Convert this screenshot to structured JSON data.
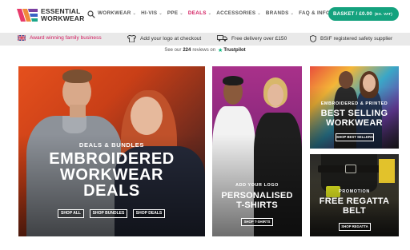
{
  "header": {
    "logo_line1": "ESSENTIAL",
    "logo_line2": "WORKWEAR",
    "nav": [
      {
        "label": "WORKWEAR",
        "has_dropdown": true
      },
      {
        "label": "HI-VIS",
        "has_dropdown": true
      },
      {
        "label": "PPE",
        "has_dropdown": true
      },
      {
        "label": "DEALS",
        "has_dropdown": true
      },
      {
        "label": "ACCESSORIES",
        "has_dropdown": true
      },
      {
        "label": "BRANDS",
        "has_dropdown": true
      },
      {
        "label": "FAQ & INFO",
        "has_dropdown": true
      }
    ],
    "basket_label": "BASKET / £0.00",
    "basket_ex": "(EX. VAT)"
  },
  "usp": {
    "award": "Award winning family business",
    "logo": "Add your logo at checkout",
    "delivery": "Free delivery over £150",
    "bsif": "BSIF registered safety supplier"
  },
  "trustpilot": {
    "prefix": "See our",
    "count": "224",
    "suffix": "reviews on",
    "brand": "Trustpilot"
  },
  "banners": {
    "main": {
      "subtitle": "DEALS & BUNDLES",
      "title_line1": "EMBROIDERED",
      "title_line2": "WORKWEAR",
      "title_line3": "DEALS",
      "buttons": [
        "SHOP ALL",
        "SHOP BUNDLES",
        "SHOP DEALS"
      ]
    },
    "tshirts": {
      "subtitle": "ADD YOUR LOGO",
      "title_line1": "PERSONALISED",
      "title_line2": "T-SHIRTS",
      "button": "SHOP T-SHIRTS"
    },
    "bestselling": {
      "subtitle": "EMBROIDERED & PRINTED",
      "title_line1": "BEST SELLING",
      "title_line2": "WORKWEAR",
      "button": "SHOP BEST SELLERS"
    },
    "belt": {
      "subtitle": "PROMOTION",
      "title_line1": "FREE REGATTA",
      "title_line2": "BELT",
      "button": "SHOP REGATTA"
    }
  },
  "colors": {
    "accent_pink": "#d2195d",
    "basket_green": "#14a27e",
    "trustpilot_green": "#00b67a"
  }
}
